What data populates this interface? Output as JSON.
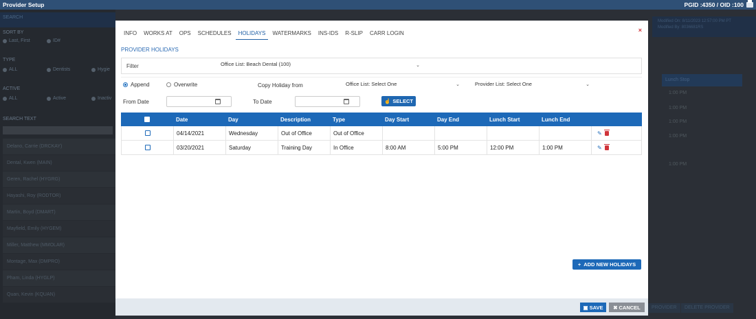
{
  "app": {
    "title": "Provider Setup",
    "pgid_oid": "PGID :4350  /  OID :100"
  },
  "background": {
    "left_panel": {
      "search_header": "SEARCH",
      "sort_by_label": "SORT BY",
      "sort_options": [
        "Last, First",
        "ID#"
      ],
      "type_label": "TYPE",
      "type_options": [
        "ALL",
        "Dentists",
        "Hygie"
      ],
      "active_label": "ACTIVE",
      "active_options": [
        "ALL",
        "Active",
        "Inactiv"
      ],
      "search_text_label": "SEARCH TEXT",
      "providers": [
        "Delano, Carrie (DRCKAY)",
        "Dental, Kwen (MAIN)",
        "Geren, Rachel (HYGRG)",
        "Hayashi, Roy (RODTOR)",
        "Martin, Boyd (DMART)",
        "Mayfield, Emily (HYGEM)",
        "Miller, Matthew (MMOLAR)",
        "Montage, Max (DMPRO)",
        "Pham, Linda (HYGLP)",
        "Quan, Kevin (KQUAN)"
      ]
    },
    "right_panel": {
      "modified_on": "Modified On: 8/11/2023 12:57:00 PM PT",
      "modified_by": "Modified By: 8036681RS",
      "lunch_stop_header": "Lunch Stop",
      "lunch_stop_times": [
        "1:00 PM",
        "1:00 PM",
        "1:00 PM",
        "1:00 PM",
        "1:00 PM"
      ],
      "buttons": [
        "PROVIDER",
        "DELETE PROVIDER"
      ]
    }
  },
  "modal": {
    "tabs": [
      {
        "label": "INFO"
      },
      {
        "label": "WORKS AT"
      },
      {
        "label": "OPS"
      },
      {
        "label": "SCHEDULES"
      },
      {
        "label": "HOLIDAYS"
      },
      {
        "label": "WATERMARKS"
      },
      {
        "label": "INS-IDS"
      },
      {
        "label": "R-SLIP"
      },
      {
        "label": "CARR LOGIN"
      }
    ],
    "active_tab": "HOLIDAYS",
    "close_label": "×",
    "section_title": "PROVIDER HOLIDAYS",
    "filter": {
      "label": "Filter",
      "value": "Office List: Beach Dental (100)"
    },
    "mode_options": {
      "append": "Append",
      "overwrite": "Overwrite",
      "selected": "Append"
    },
    "copy_holiday_label": "Copy Holiday from",
    "office_list_select": "Office List: Select One",
    "provider_list_select": "Provider List: Select One",
    "from_date_label": "From Date",
    "to_date_label": "To Date",
    "from_date_value": "",
    "to_date_value": "",
    "select_button": "SELECT",
    "table": {
      "columns": [
        "",
        "Date",
        "Day",
        "Description",
        "Type",
        "Day Start",
        "Day End",
        "Lunch Start",
        "Lunch End",
        ""
      ],
      "rows": [
        {
          "date": "04/14/2021",
          "day": "Wednesday",
          "description": "Out of Office",
          "type": "Out of Office",
          "day_start": "",
          "day_end": "",
          "lunch_start": "",
          "lunch_end": ""
        },
        {
          "date": "03/20/2021",
          "day": "Saturday",
          "description": "Training Day",
          "type": "In Office",
          "day_start": "8:00 AM",
          "day_end": "5:00 PM",
          "lunch_start": "12:00 PM",
          "lunch_end": "1:00 PM"
        }
      ]
    },
    "add_button": "ADD NEW HOLIDAYS",
    "save_button": "SAVE",
    "cancel_button": "CANCEL"
  },
  "colors": {
    "primary": "#1d69b8",
    "topbar": "#2f5076",
    "danger": "#d0343a",
    "footer": "#e3e9ef"
  }
}
